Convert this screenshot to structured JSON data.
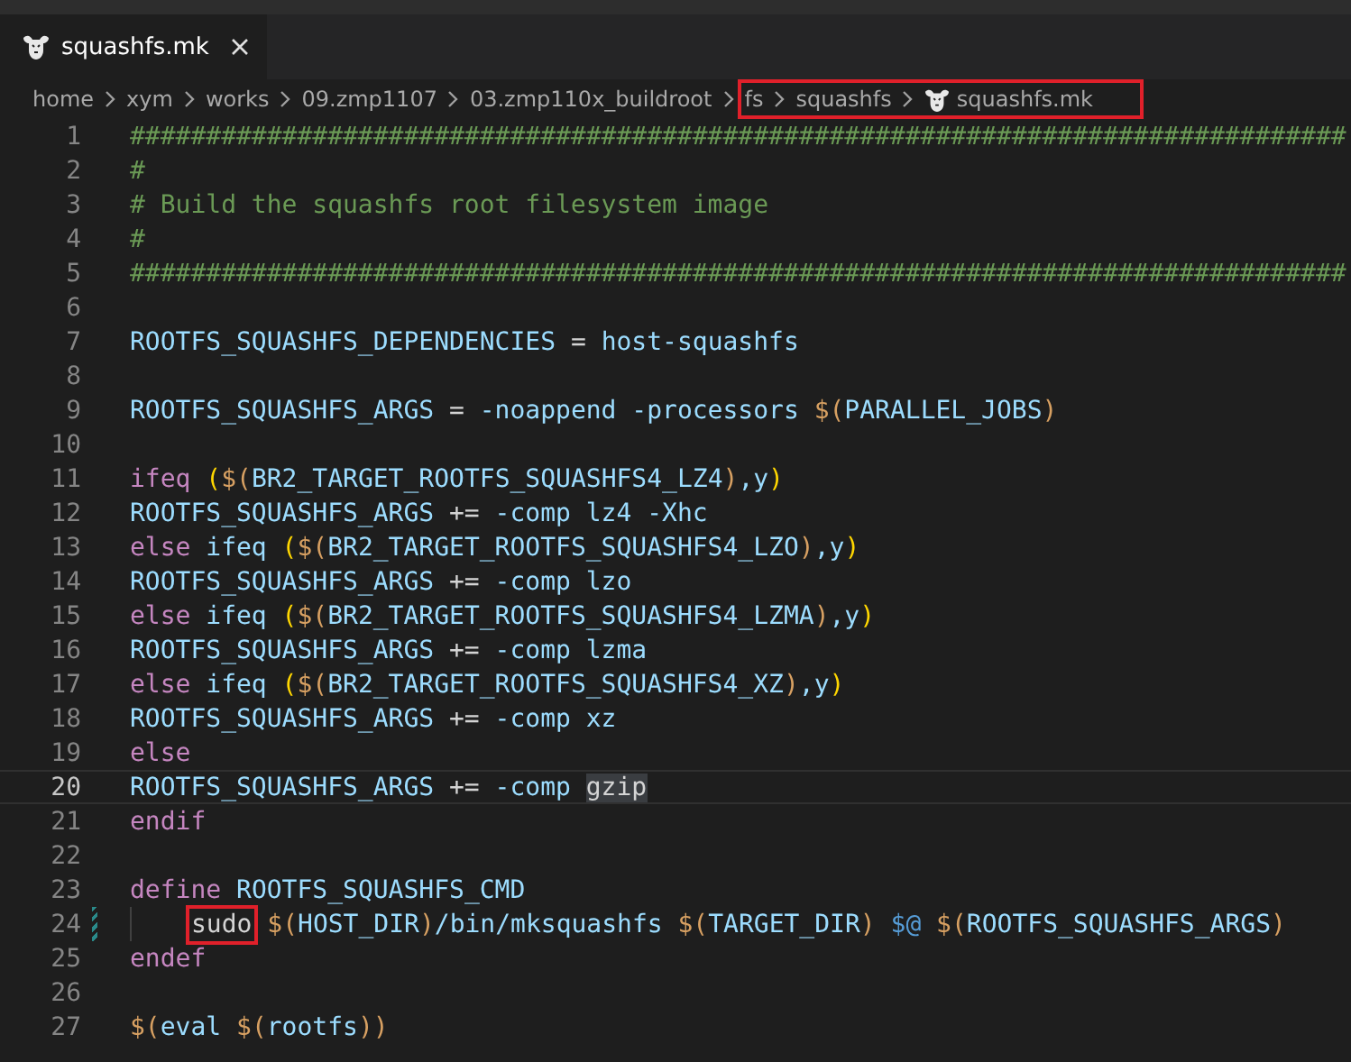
{
  "tab": {
    "title": "squashfs.mk",
    "selected": true
  },
  "breadcrumbs": [
    {
      "label": "home",
      "boxed": false,
      "icon": false
    },
    {
      "label": "xym",
      "boxed": false,
      "icon": false
    },
    {
      "label": "works",
      "boxed": false,
      "icon": false
    },
    {
      "label": "09.zmp1107",
      "boxed": false,
      "icon": false
    },
    {
      "label": "03.zmp110x_buildroot",
      "boxed": false,
      "icon": false
    },
    {
      "label": "fs",
      "boxed": true,
      "icon": false
    },
    {
      "label": "squashfs",
      "boxed": true,
      "icon": false
    },
    {
      "label": "squashfs.mk",
      "boxed": true,
      "icon": true
    }
  ],
  "lines": [
    {
      "number": "1",
      "current": false,
      "changed": false,
      "indented": false,
      "tokens": [
        {
          "kind": "comment",
          "text": "################################################################################"
        }
      ]
    },
    {
      "number": "2",
      "current": false,
      "changed": false,
      "indented": false,
      "tokens": [
        {
          "kind": "comment",
          "text": "#"
        }
      ]
    },
    {
      "number": "3",
      "current": false,
      "changed": false,
      "indented": false,
      "tokens": [
        {
          "kind": "comment",
          "text": "# Build the squashfs root filesystem image"
        }
      ]
    },
    {
      "number": "4",
      "current": false,
      "changed": false,
      "indented": false,
      "tokens": [
        {
          "kind": "comment",
          "text": "#"
        }
      ]
    },
    {
      "number": "5",
      "current": false,
      "changed": false,
      "indented": false,
      "tokens": [
        {
          "kind": "comment",
          "text": "################################################################################"
        }
      ]
    },
    {
      "number": "6",
      "current": false,
      "changed": false,
      "indented": false
    },
    {
      "number": "7",
      "current": false,
      "changed": false,
      "indented": false,
      "tokens": [
        {
          "kind": "variable",
          "text": "ROOTFS_SQUASHFS_DEPENDENCIES"
        },
        {
          "kind": "plain",
          "text": " = "
        },
        {
          "kind": "variable",
          "text": "host-squashfs"
        }
      ]
    },
    {
      "number": "8",
      "current": false,
      "changed": false,
      "indented": false
    },
    {
      "number": "9",
      "current": false,
      "changed": false,
      "indented": false,
      "tokens": [
        {
          "kind": "variable",
          "text": "ROOTFS_SQUASHFS_ARGS"
        },
        {
          "kind": "plain",
          "text": " = "
        },
        {
          "kind": "variable",
          "text": "-noappend -processors "
        },
        {
          "kind": "func",
          "text": "$("
        },
        {
          "kind": "variable",
          "text": "PARALLEL_JOBS"
        },
        {
          "kind": "func",
          "text": ")"
        }
      ]
    },
    {
      "number": "10",
      "current": false,
      "changed": false,
      "indented": false
    },
    {
      "number": "11",
      "current": false,
      "changed": false,
      "indented": false,
      "tokens": [
        {
          "kind": "keyword",
          "text": "ifeq "
        },
        {
          "kind": "paren",
          "text": "("
        },
        {
          "kind": "func",
          "text": "$("
        },
        {
          "kind": "variable",
          "text": "BR2_TARGET_ROOTFS_SQUASHFS4_LZ4"
        },
        {
          "kind": "func",
          "text": ")"
        },
        {
          "kind": "variable",
          "text": ",y"
        },
        {
          "kind": "paren",
          "text": ")"
        }
      ]
    },
    {
      "number": "12",
      "current": false,
      "changed": false,
      "indented": false,
      "tokens": [
        {
          "kind": "variable",
          "text": "ROOTFS_SQUASHFS_ARGS"
        },
        {
          "kind": "plain",
          "text": " += "
        },
        {
          "kind": "variable",
          "text": "-comp lz4 -Xhc"
        }
      ]
    },
    {
      "number": "13",
      "current": false,
      "changed": false,
      "indented": false,
      "tokens": [
        {
          "kind": "keyword",
          "text": "else"
        },
        {
          "kind": "variable",
          "text": " ifeq "
        },
        {
          "kind": "paren",
          "text": "("
        },
        {
          "kind": "func",
          "text": "$("
        },
        {
          "kind": "variable",
          "text": "BR2_TARGET_ROOTFS_SQUASHFS4_LZO"
        },
        {
          "kind": "func",
          "text": ")"
        },
        {
          "kind": "variable",
          "text": ",y"
        },
        {
          "kind": "paren",
          "text": ")"
        }
      ]
    },
    {
      "number": "14",
      "current": false,
      "changed": false,
      "indented": false,
      "tokens": [
        {
          "kind": "variable",
          "text": "ROOTFS_SQUASHFS_ARGS"
        },
        {
          "kind": "plain",
          "text": " += "
        },
        {
          "kind": "variable",
          "text": "-comp lzo"
        }
      ]
    },
    {
      "number": "15",
      "current": false,
      "changed": false,
      "indented": false,
      "tokens": [
        {
          "kind": "keyword",
          "text": "else"
        },
        {
          "kind": "variable",
          "text": " ifeq "
        },
        {
          "kind": "paren",
          "text": "("
        },
        {
          "kind": "func",
          "text": "$("
        },
        {
          "kind": "variable",
          "text": "BR2_TARGET_ROOTFS_SQUASHFS4_LZMA"
        },
        {
          "kind": "func",
          "text": ")"
        },
        {
          "kind": "variable",
          "text": ",y"
        },
        {
          "kind": "paren",
          "text": ")"
        }
      ]
    },
    {
      "number": "16",
      "current": false,
      "changed": false,
      "indented": false,
      "tokens": [
        {
          "kind": "variable",
          "text": "ROOTFS_SQUASHFS_ARGS"
        },
        {
          "kind": "plain",
          "text": " += "
        },
        {
          "kind": "variable",
          "text": "-comp lzma"
        }
      ]
    },
    {
      "number": "17",
      "current": false,
      "changed": false,
      "indented": false,
      "tokens": [
        {
          "kind": "keyword",
          "text": "else"
        },
        {
          "kind": "variable",
          "text": " ifeq "
        },
        {
          "kind": "paren",
          "text": "("
        },
        {
          "kind": "func",
          "text": "$("
        },
        {
          "kind": "variable",
          "text": "BR2_TARGET_ROOTFS_SQUASHFS4_XZ"
        },
        {
          "kind": "func",
          "text": ")"
        },
        {
          "kind": "variable",
          "text": ",y"
        },
        {
          "kind": "paren",
          "text": ")"
        }
      ]
    },
    {
      "number": "18",
      "current": false,
      "changed": false,
      "indented": false,
      "tokens": [
        {
          "kind": "variable",
          "text": "ROOTFS_SQUASHFS_ARGS"
        },
        {
          "kind": "plain",
          "text": " += "
        },
        {
          "kind": "variable",
          "text": "-comp xz"
        }
      ]
    },
    {
      "number": "19",
      "current": false,
      "changed": false,
      "indented": false,
      "tokens": [
        {
          "kind": "keyword",
          "text": "else"
        }
      ]
    },
    {
      "number": "20",
      "current": true,
      "changed": false,
      "indented": false,
      "tokens": [
        {
          "kind": "variable",
          "text": "ROOTFS_SQUASHFS_ARGS"
        },
        {
          "kind": "plain",
          "text": " += "
        },
        {
          "kind": "variable",
          "text": "-comp "
        },
        {
          "kind": "word-match",
          "text": "gzip"
        }
      ]
    },
    {
      "number": "21",
      "current": false,
      "changed": false,
      "indented": false,
      "tokens": [
        {
          "kind": "keyword",
          "text": "endif"
        }
      ]
    },
    {
      "number": "22",
      "current": false,
      "changed": false,
      "indented": false
    },
    {
      "number": "23",
      "current": false,
      "changed": false,
      "indented": false,
      "tokens": [
        {
          "kind": "keyword",
          "text": "define "
        },
        {
          "kind": "variable",
          "text": "ROOTFS_SQUASHFS_CMD"
        }
      ]
    },
    {
      "number": "24",
      "current": false,
      "changed": true,
      "indented": true,
      "tokens": [
        {
          "kind": "annotated",
          "text": "sudo"
        },
        {
          "kind": "func",
          "text": " $("
        },
        {
          "kind": "variable",
          "text": "HOST_DIR"
        },
        {
          "kind": "func",
          "text": ")"
        },
        {
          "kind": "variable",
          "text": "/bin/mksquashfs "
        },
        {
          "kind": "func",
          "text": "$("
        },
        {
          "kind": "variable",
          "text": "TARGET_DIR"
        },
        {
          "kind": "func",
          "text": ") "
        },
        {
          "kind": "auto",
          "text": "$@"
        },
        {
          "kind": "func",
          "text": " $("
        },
        {
          "kind": "variable",
          "text": "ROOTFS_SQUASHFS_ARGS"
        },
        {
          "kind": "func",
          "text": ")"
        }
      ]
    },
    {
      "number": "25",
      "current": false,
      "changed": false,
      "indented": false,
      "tokens": [
        {
          "kind": "keyword",
          "text": "endef"
        }
      ]
    },
    {
      "number": "26",
      "current": false,
      "changed": false,
      "indented": false
    },
    {
      "number": "27",
      "current": false,
      "changed": false,
      "indented": false,
      "tokens": [
        {
          "kind": "func",
          "text": "$("
        },
        {
          "kind": "variable",
          "text": "eval "
        },
        {
          "kind": "func",
          "text": "$("
        },
        {
          "kind": "variable",
          "text": "rootfs"
        },
        {
          "kind": "func",
          "text": "))"
        }
      ]
    }
  ]
}
